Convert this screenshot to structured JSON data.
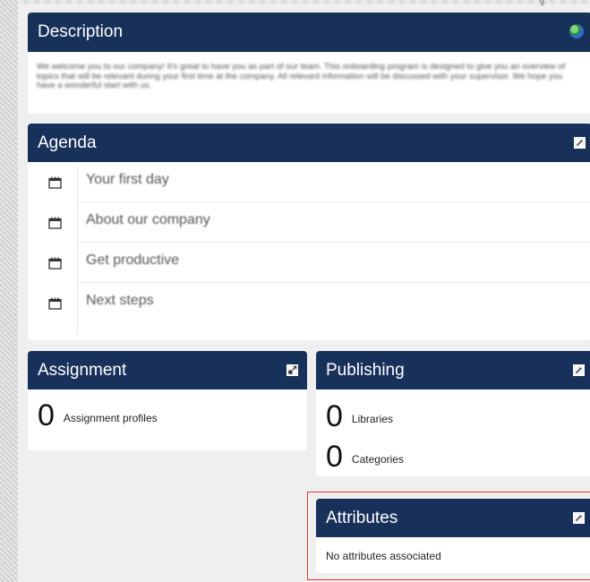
{
  "top_corner_text": "g.",
  "description": {
    "title": "Description",
    "icon": "globe-icon",
    "text": "We welcome you to our company! It's great to have you as part of our team. This onboarding program is designed to give you an overview of topics that will be relevant during your first time at the company. All relevant information will be discussed with your supervisor. We hope you have a wonderful start with us."
  },
  "agenda": {
    "title": "Agenda",
    "items": [
      {
        "label": "Your first day"
      },
      {
        "label": "About our company"
      },
      {
        "label": "Get productive"
      },
      {
        "label": "Next steps"
      }
    ]
  },
  "assignment": {
    "title": "Assignment",
    "stats": [
      {
        "value": "0",
        "label": "Assignment profiles"
      }
    ]
  },
  "publishing": {
    "title": "Publishing",
    "stats": [
      {
        "value": "0",
        "label": "Libraries"
      },
      {
        "value": "0",
        "label": "Categories"
      }
    ]
  },
  "attributes": {
    "title": "Attributes",
    "empty_text": "No attributes associated",
    "highlight_color": "#e23b3b"
  },
  "colors": {
    "header_bg": "#18315a",
    "page_bg": "#efefef"
  }
}
